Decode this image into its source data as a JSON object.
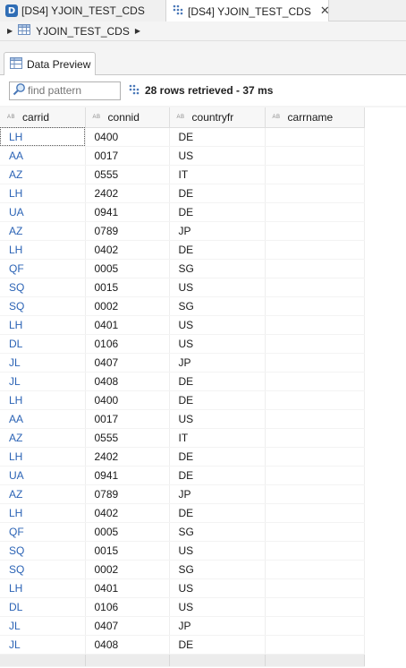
{
  "editor_tabs": [
    {
      "label": "[DS4] YJOIN_TEST_CDS",
      "icon": "ds-icon",
      "active": false
    },
    {
      "label": "[DS4] YJOIN_TEST_CDS",
      "icon": "cds-view-icon",
      "active": true,
      "close": "✕"
    }
  ],
  "breadcrumb": {
    "label": "YJOIN_TEST_CDS",
    "icon": "table-icon"
  },
  "view_tab": {
    "label": "Data Preview",
    "icon": "data-preview-icon"
  },
  "toolbar": {
    "search_placeholder": "find pattern",
    "status": "28 rows retrieved - 37 ms"
  },
  "columns": [
    "carrid",
    "connid",
    "countryfr",
    "carrname"
  ],
  "rows": [
    [
      "LH",
      "0400",
      "DE",
      ""
    ],
    [
      "AA",
      "0017",
      "US",
      ""
    ],
    [
      "AZ",
      "0555",
      "IT",
      ""
    ],
    [
      "LH",
      "2402",
      "DE",
      ""
    ],
    [
      "UA",
      "0941",
      "DE",
      ""
    ],
    [
      "AZ",
      "0789",
      "JP",
      ""
    ],
    [
      "LH",
      "0402",
      "DE",
      ""
    ],
    [
      "QF",
      "0005",
      "SG",
      ""
    ],
    [
      "SQ",
      "0015",
      "US",
      ""
    ],
    [
      "SQ",
      "0002",
      "SG",
      ""
    ],
    [
      "LH",
      "0401",
      "US",
      ""
    ],
    [
      "DL",
      "0106",
      "US",
      ""
    ],
    [
      "JL",
      "0407",
      "JP",
      ""
    ],
    [
      "JL",
      "0408",
      "DE",
      ""
    ],
    [
      "LH",
      "0400",
      "DE",
      ""
    ],
    [
      "AA",
      "0017",
      "US",
      ""
    ],
    [
      "AZ",
      "0555",
      "IT",
      ""
    ],
    [
      "LH",
      "2402",
      "DE",
      ""
    ],
    [
      "UA",
      "0941",
      "DE",
      ""
    ],
    [
      "AZ",
      "0789",
      "JP",
      ""
    ],
    [
      "LH",
      "0402",
      "DE",
      ""
    ],
    [
      "QF",
      "0005",
      "SG",
      ""
    ],
    [
      "SQ",
      "0015",
      "US",
      ""
    ],
    [
      "SQ",
      "0002",
      "SG",
      ""
    ],
    [
      "LH",
      "0401",
      "US",
      ""
    ],
    [
      "DL",
      "0106",
      "US",
      ""
    ],
    [
      "JL",
      "0407",
      "JP",
      ""
    ],
    [
      "JL",
      "0408",
      "DE",
      ""
    ]
  ],
  "colors": {
    "accent": "#2f6db5",
    "key_text": "#2b63b5"
  }
}
